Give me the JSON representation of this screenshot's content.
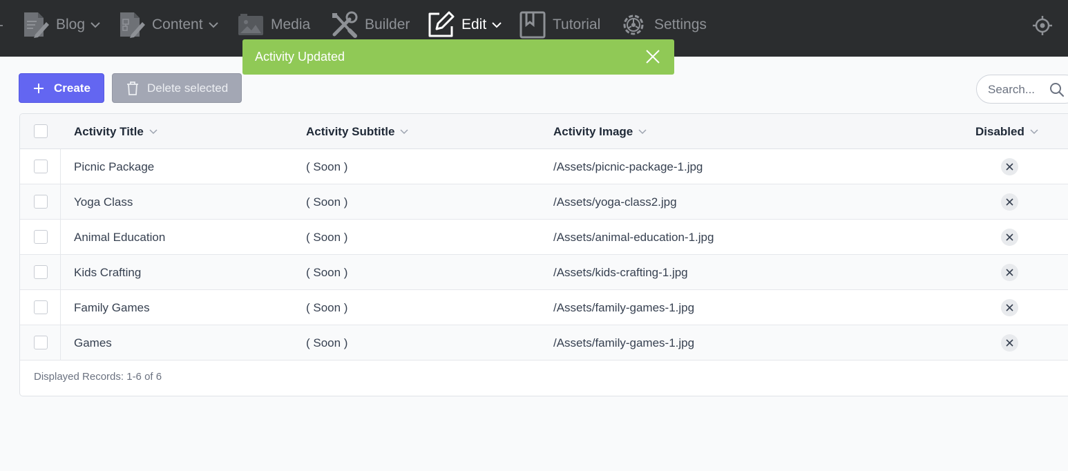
{
  "nav": {
    "items": [
      {
        "label": "Blog",
        "icon": "blog-document-icon",
        "dropdown": true
      },
      {
        "label": "Content",
        "icon": "content-document-icon",
        "dropdown": true
      },
      {
        "label": "Media",
        "icon": "media-image-icon",
        "dropdown": false
      },
      {
        "label": "Builder",
        "icon": "builder-tools-icon",
        "dropdown": false
      },
      {
        "label": "Edit",
        "icon": "edit-pencil-icon",
        "dropdown": true,
        "active": true
      },
      {
        "label": "Tutorial",
        "icon": "tutorial-bookmark-icon",
        "dropdown": false
      },
      {
        "label": "Settings",
        "icon": "settings-gear-icon",
        "dropdown": false
      }
    ],
    "right_icon": "locate-crosshair-icon"
  },
  "toast": {
    "message": "Activity Updated",
    "color": "#90c956"
  },
  "toolbar": {
    "create_label": "Create",
    "delete_label": "Delete selected"
  },
  "search": {
    "placeholder": "Search..."
  },
  "table": {
    "columns": [
      "Activity Title",
      "Activity Subtitle",
      "Activity Image",
      "Disabled"
    ],
    "rows": [
      {
        "title": "Picnic Package",
        "subtitle": "( Soon )",
        "image": "/Assets/picnic-package-1.jpg",
        "disabled": false
      },
      {
        "title": "Yoga Class",
        "subtitle": "( Soon )",
        "image": "/Assets/yoga-class2.jpg",
        "disabled": false
      },
      {
        "title": "Animal Education",
        "subtitle": "( Soon )",
        "image": "/Assets/animal-education-1.jpg",
        "disabled": false
      },
      {
        "title": "Kids Crafting",
        "subtitle": "( Soon )",
        "image": "/Assets/kids-crafting-1.jpg",
        "disabled": false
      },
      {
        "title": "Family Games",
        "subtitle": "( Soon )",
        "image": "/Assets/family-games-1.jpg",
        "disabled": false
      },
      {
        "title": "Games",
        "subtitle": "( Soon )",
        "image": "/Assets/family-games-1.jpg",
        "disabled": false
      }
    ],
    "footer": "Displayed Records: 1-6 of 6"
  },
  "colors": {
    "nav_bg": "#2b2d2f",
    "primary": "#6366f1",
    "toast_success": "#90c956"
  }
}
